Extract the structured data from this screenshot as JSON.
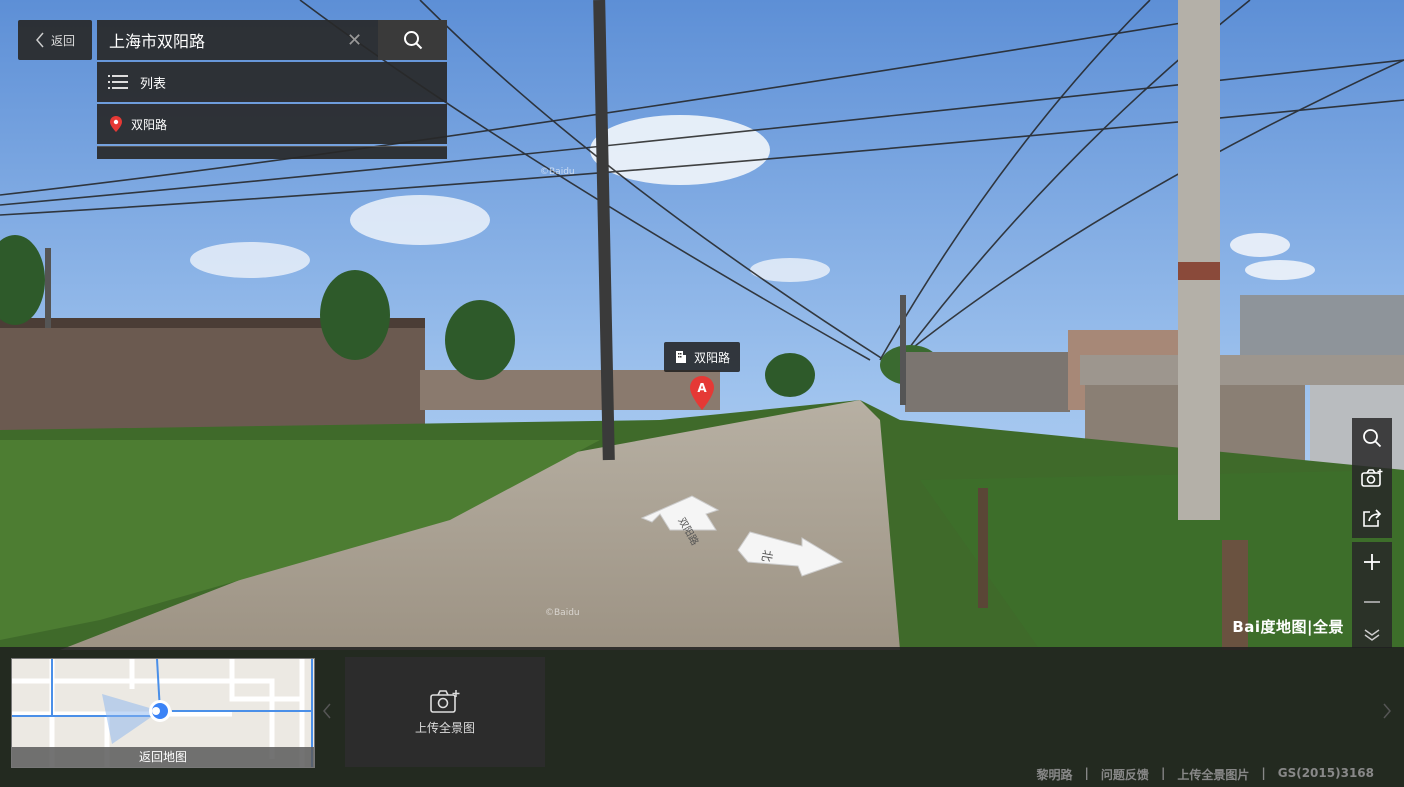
{
  "top": {
    "back_label": "返回",
    "search_value": "上海市双阳路",
    "list_label": "列表",
    "result_label": "双阳路"
  },
  "poi": {
    "label": "双阳路",
    "marker_letter": "A"
  },
  "arrows": {
    "forward": "双阳路",
    "right": "北"
  },
  "tools": [
    "search-icon",
    "camera-icon",
    "share-icon",
    "plus-icon",
    "minus-icon",
    "chevron-down-icon"
  ],
  "minimap": {
    "caption": "返回地图"
  },
  "upload": {
    "label": "上传全景图"
  },
  "footer": {
    "items": [
      "黎明路",
      "|",
      "问题反馈",
      "|",
      "上传全景图片",
      "|",
      "GS(2015)3168"
    ]
  },
  "logo": "Bai度地图|全景",
  "watermarks": [
    "©Baidu"
  ],
  "colors": {
    "accent": "#e53935",
    "panel": "#282828",
    "map_blue": "#3b83f6"
  }
}
